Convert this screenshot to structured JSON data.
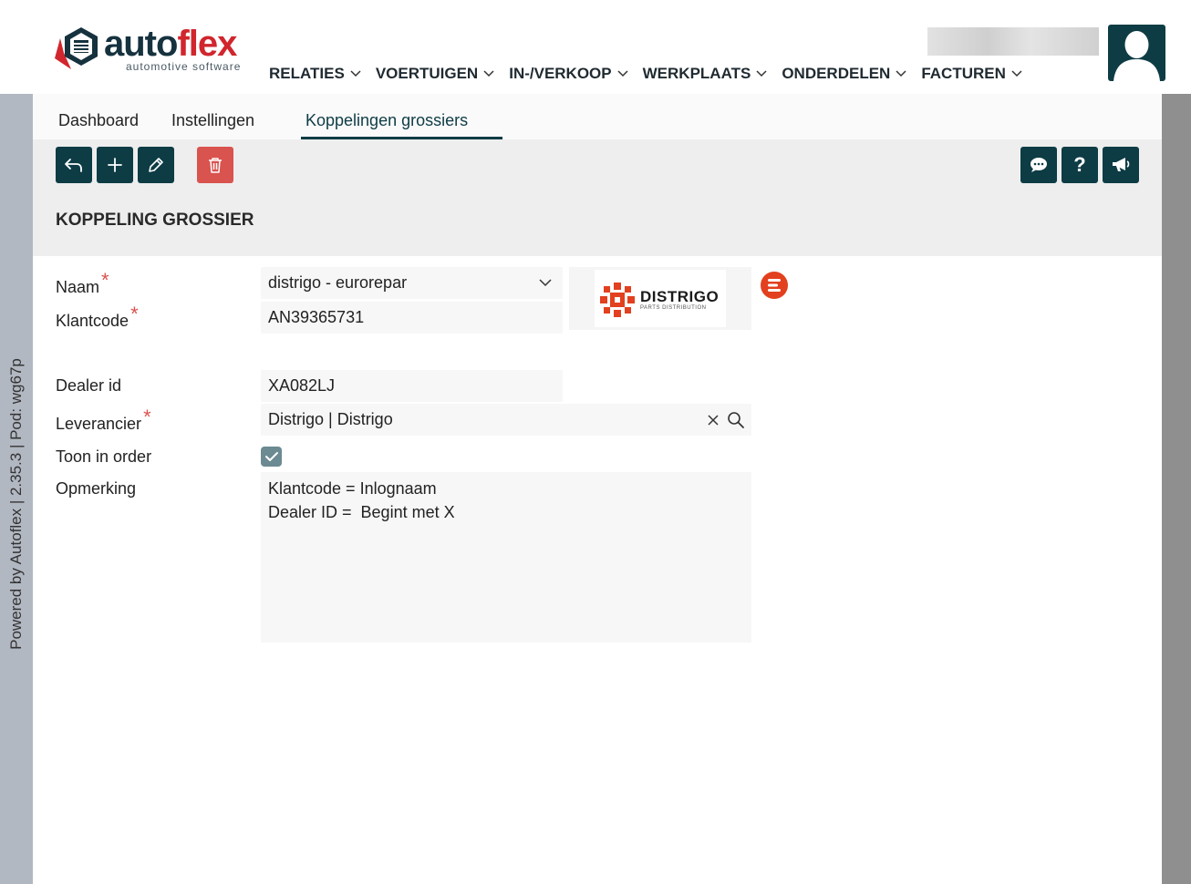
{
  "app": {
    "logo_word_a": "auto",
    "logo_word_b": "flex",
    "logo_tagline": "automotive software",
    "accent": "#0d3c45",
    "danger": "#d9534f",
    "brand_red": "#d1262d"
  },
  "mainnav": [
    {
      "label": "RELATIES"
    },
    {
      "label": "VOERTUIGEN"
    },
    {
      "label": "IN-/VERKOOP"
    },
    {
      "label": "WERKPLAATS"
    },
    {
      "label": "ONDERDELEN"
    },
    {
      "label": "FACTUREN"
    }
  ],
  "sidebar": {
    "powered_by": "Powered by Autoflex | 2.35.3 | Pod: wg67p"
  },
  "tabs": [
    {
      "label": "Dashboard"
    },
    {
      "label": "Instellingen"
    },
    {
      "label": "Koppelingen grossiers",
      "active": true
    }
  ],
  "toolbar": {
    "buttons_left": [
      "back-icon",
      "plus-icon",
      "pencil-icon",
      "trash-icon"
    ],
    "buttons_right": [
      "chat-icon",
      "help-icon",
      "megaphone-icon"
    ],
    "help_glyph": "?"
  },
  "page": {
    "title": "KOPPELING GROSSIER"
  },
  "form": {
    "naam": {
      "label": "Naam",
      "required": "*",
      "value": "distrigo - eurorepar"
    },
    "klantcode": {
      "label": "Klantcode",
      "required": "*",
      "value": "AN39365731"
    },
    "dealer_id": {
      "label": "Dealer id",
      "value": "XA082LJ"
    },
    "leverancier": {
      "label": "Leverancier",
      "required": "*",
      "value": "Distrigo | Distrigo"
    },
    "toon_in_order": {
      "label": "Toon in order",
      "checked": true
    },
    "opmerking": {
      "label": "Opmerking",
      "value": "Klantcode = Inlognaam\nDealer ID =  Begint met X"
    }
  },
  "supplier_logo": {
    "name": "DISTRIGO",
    "sub": "PARTS DISTRIBUTION",
    "color": "#e2401e"
  }
}
